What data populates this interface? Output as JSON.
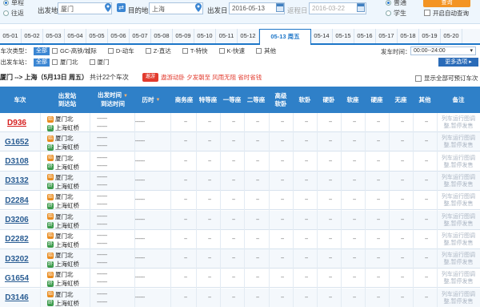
{
  "search": {
    "trip_types": [
      "单程",
      "往返"
    ],
    "from_label": "出发地",
    "from_value": "厦门",
    "to_label": "目的地",
    "to_value": "上海",
    "date_label": "出发日",
    "date_value": "2016-05-13",
    "return_label": "返程日",
    "return_value": "2016-03-22",
    "passenger_types": [
      "普通",
      "学生"
    ],
    "query_label": "查询",
    "auto_query_label": "开启自动查询"
  },
  "dates": [
    "05-01",
    "05-02",
    "05-03",
    "05-04",
    "05-05",
    "05-06",
    "05-07",
    "05-08",
    "05-09",
    "05-10",
    "05-11",
    "05-12",
    "05-13 周五",
    "05-14",
    "05-15",
    "05-16",
    "05-17",
    "05-18",
    "05-19",
    "05-20"
  ],
  "filters": {
    "type_label": "车次类型：",
    "station_label": "出发车站：",
    "all_label": "全部",
    "types": [
      "GC-高铁/城际",
      "D-动车",
      "Z-直达",
      "T-特快",
      "K-快速",
      "其他"
    ],
    "stations": [
      "厦门北",
      "厦门"
    ],
    "time_label": "发车时间：",
    "time_value": "00:00--24:00",
    "more_label": "更多选项"
  },
  "summary": {
    "route": "厦门 --> 上海（5月13日 周五）",
    "count_text": "共计22个车次",
    "promo_logo": "遨游",
    "promo_text": "遨游动卧 夕发朝至 风雨无阻 省时省钱",
    "show_all_label": "显示全部可预订车次"
  },
  "headers": {
    "train": "车次",
    "station1": "出发站",
    "station2": "到达站",
    "time1": "出发时间",
    "time2": "到达时间",
    "duration": "历时",
    "business": "商务座",
    "special": "特等座",
    "first": "一等座",
    "second": "二等座",
    "soft_premium1": "高级",
    "soft_premium2": "软卧",
    "soft_sleeper": "软卧",
    "hard_sleeper": "硬卧",
    "soft_seat": "软座",
    "hard_seat": "硬座",
    "no_seat": "无座",
    "other": "其他",
    "remark": "备注"
  },
  "start_badge": "始",
  "end_badge": "终",
  "seat_value": "--",
  "time_dash": "-------",
  "note_text": "列车运行图调整,暂停发售",
  "rows": [
    {
      "train": "D936",
      "from": "厦门北",
      "to": "上海虹桥"
    },
    {
      "train": "G1652",
      "from": "厦门北",
      "to": "上海虹桥"
    },
    {
      "train": "D3108",
      "from": "厦门北",
      "to": "上海虹桥"
    },
    {
      "train": "D3132",
      "from": "厦门北",
      "to": "上海虹桥"
    },
    {
      "train": "D2284",
      "from": "厦门北",
      "to": "上海虹桥"
    },
    {
      "train": "D3206",
      "from": "厦门北",
      "to": "上海虹桥"
    },
    {
      "train": "D2282",
      "from": "厦门北",
      "to": "上海虹桥"
    },
    {
      "train": "D3202",
      "from": "厦门北",
      "to": "上海虹桥"
    },
    {
      "train": "G1654",
      "from": "厦门北",
      "to": "上海虹桥"
    },
    {
      "train": "D3146",
      "from": "厦门北",
      "to": "上海虹桥"
    }
  ],
  "colors": {
    "header_blue": "#2f80c8",
    "train_red": "#d61f1f",
    "accent_orange": "#f39423"
  }
}
